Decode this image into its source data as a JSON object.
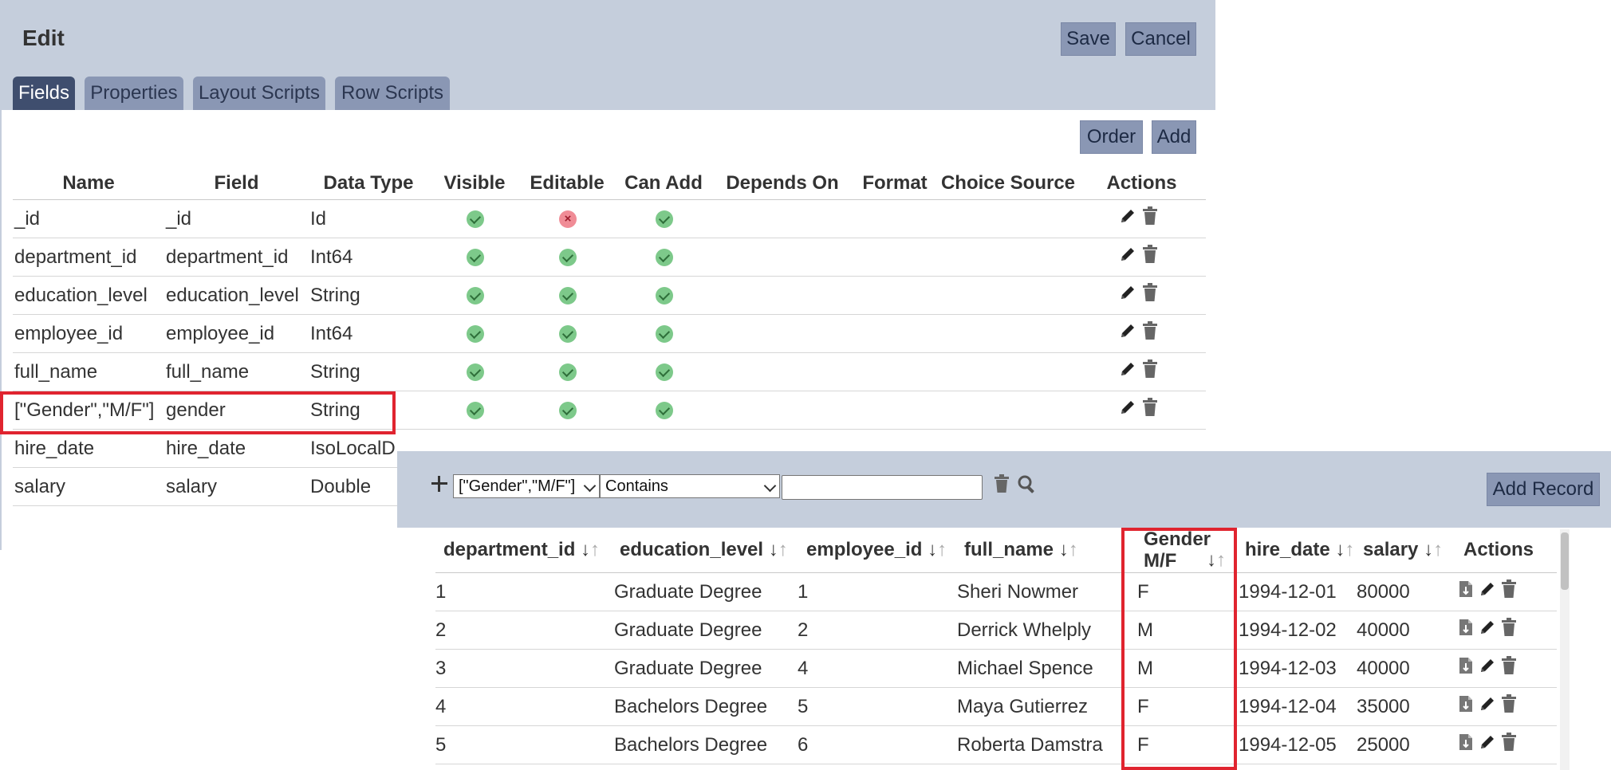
{
  "edit": {
    "title": "Edit",
    "save_label": "Save",
    "cancel_label": "Cancel",
    "tabs": [
      {
        "label": "Fields",
        "active": true
      },
      {
        "label": "Properties",
        "active": false
      },
      {
        "label": "Layout Scripts",
        "active": false
      },
      {
        "label": "Row Scripts",
        "active": false
      }
    ],
    "order_label": "Order",
    "add_label": "Add",
    "columns": [
      "Name",
      "Field",
      "Data Type",
      "Visible",
      "Editable",
      "Can Add",
      "Depends On",
      "Format",
      "Choice Source",
      "Actions"
    ],
    "rows": [
      {
        "name": "_id",
        "field": "_id",
        "type": "Id",
        "visible": true,
        "editable": false,
        "can_add": true
      },
      {
        "name": "department_id",
        "field": "department_id",
        "type": "Int64",
        "visible": true,
        "editable": true,
        "can_add": true
      },
      {
        "name": "education_level",
        "field": "education_level",
        "type": "String",
        "visible": true,
        "editable": true,
        "can_add": true
      },
      {
        "name": "employee_id",
        "field": "employee_id",
        "type": "Int64",
        "visible": true,
        "editable": true,
        "can_add": true
      },
      {
        "name": "full_name",
        "field": "full_name",
        "type": "String",
        "visible": true,
        "editable": true,
        "can_add": true
      },
      {
        "name": "[\"Gender\",\"M/F\"]",
        "field": "gender",
        "type": "String",
        "visible": true,
        "editable": true,
        "can_add": true
      },
      {
        "name": "hire_date",
        "field": "hire_date",
        "type": "IsoLocalD",
        "visible": null,
        "editable": null,
        "can_add": null
      },
      {
        "name": "salary",
        "field": "salary",
        "type": "Double",
        "visible": null,
        "editable": null,
        "can_add": null
      }
    ]
  },
  "records": {
    "filter_field": "[\"Gender\",\"M/F\"]",
    "filter_op": "Contains",
    "filter_value": "",
    "add_record_label": "Add Record",
    "columns": [
      "department_id",
      "education_level",
      "employee_id",
      "full_name",
      "Gender M/F",
      "hire_date",
      "salary",
      "Actions"
    ],
    "gender_header": {
      "line1": "Gender",
      "line2": "M/F"
    },
    "rows": [
      [
        "1",
        "Graduate Degree",
        "1",
        "Sheri Nowmer",
        "F",
        "1994-12-01",
        "80000"
      ],
      [
        "2",
        "Graduate Degree",
        "2",
        "Derrick Whelply",
        "M",
        "1994-12-02",
        "40000"
      ],
      [
        "3",
        "Graduate Degree",
        "4",
        "Michael Spence",
        "M",
        "1994-12-03",
        "40000"
      ],
      [
        "4",
        "Bachelors Degree",
        "5",
        "Maya Gutierrez",
        "F",
        "1994-12-04",
        "35000"
      ],
      [
        "5",
        "Bachelors Degree",
        "6",
        "Roberta Damstra",
        "F",
        "1994-12-05",
        "25000"
      ]
    ]
  },
  "colors": {
    "panel_bg": "#c5cedc",
    "button_bg": "#8a97b4",
    "tab_active": "#3f4e6e",
    "highlight": "#e0242f"
  }
}
